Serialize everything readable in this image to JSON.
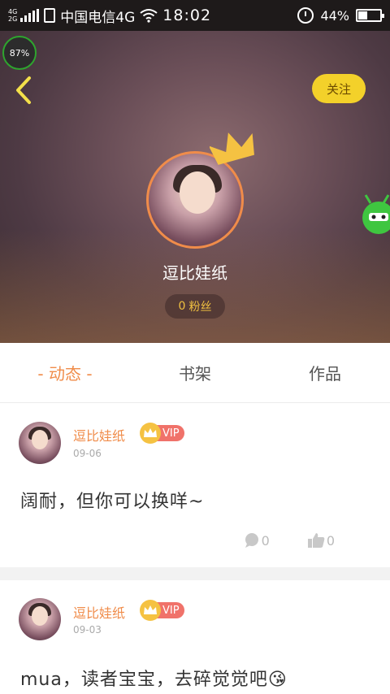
{
  "status_bar": {
    "network_top": "4G",
    "network_bottom": "2G",
    "carrier": "中国电信4G",
    "time": "18:02",
    "battery_percent": "44%",
    "battery_level": 0.44
  },
  "floating_badge": {
    "value": "87%"
  },
  "header": {
    "follow_label": "关注",
    "username": "逗比娃纸",
    "fans_count": "0",
    "fans_label": "粉丝"
  },
  "tabs": [
    {
      "label": "- 动态 -",
      "active": true
    },
    {
      "label": "书架",
      "active": false
    },
    {
      "label": "作品",
      "active": false
    }
  ],
  "posts": [
    {
      "author": "逗比娃纸",
      "vip_label": "VIP",
      "date": "09-06",
      "content": "阔耐，但你可以换咩~",
      "comment_count": "0",
      "like_count": "0"
    },
    {
      "author": "逗比娃纸",
      "vip_label": "VIP",
      "date": "09-03",
      "content": "mua，读者宝宝，去碎觉觉吧😘"
    }
  ],
  "colors": {
    "accent": "#f08c4a",
    "follow_button": "#f3d12a",
    "vip_badge": "#f0726a",
    "status_bar": "#1e1a1a"
  }
}
